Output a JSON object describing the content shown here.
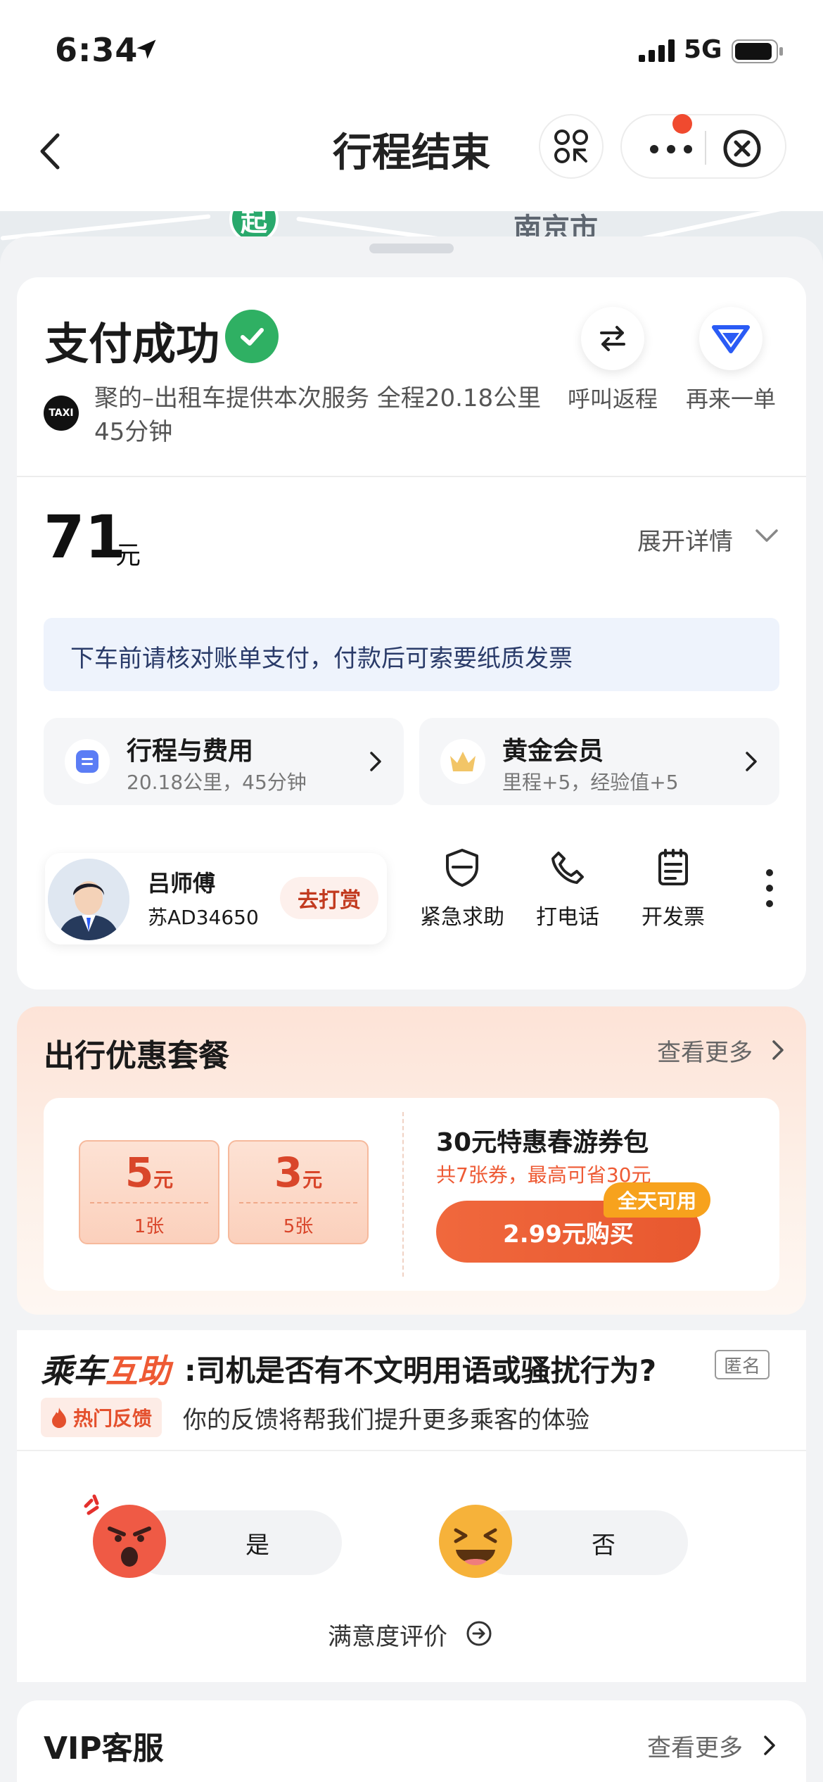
{
  "status_bar": {
    "time": "6:34",
    "network": "5G"
  },
  "nav": {
    "title": "行程结束"
  },
  "map": {
    "place_label": "南京市",
    "start_marker": "起"
  },
  "payment": {
    "title": "支付成功",
    "taxi_logo": "TAXI",
    "service_text": "聚的–出租车提供本次服务 全程20.18公里 45分钟",
    "actions": [
      {
        "label": "呼叫返程"
      },
      {
        "label": "再来一单"
      }
    ],
    "amount": "71",
    "amount_unit": "元",
    "expand_label": "展开详情",
    "notice": "下车前请核对账单支付，付款后可索要纸质发票"
  },
  "tiles": [
    {
      "title": "行程与费用",
      "subtitle": "20.18公里，45分钟"
    },
    {
      "title": "黄金会员",
      "subtitle": "里程+5，经验值+5"
    }
  ],
  "driver": {
    "name": "吕师傅",
    "plate": "苏AD34650",
    "tip_label": "去打赏"
  },
  "tools": [
    {
      "label": "紧急求助",
      "icon": "shield-icon"
    },
    {
      "label": "打电话",
      "icon": "phone-icon"
    },
    {
      "label": "开发票",
      "icon": "receipt-icon"
    }
  ],
  "promo": {
    "title": "出行优惠套餐",
    "more_label": "查看更多",
    "coupons": [
      {
        "value": "5",
        "unit": "元",
        "count": "1张"
      },
      {
        "value": "3",
        "unit": "元",
        "count": "5张"
      }
    ],
    "package_title": "30元特惠春游券包",
    "package_sub": "共7张券，最高可省30元",
    "badge": "全天可用",
    "buy_label": "2.99元购买"
  },
  "feedback": {
    "brand_prefix": "乘车",
    "brand_highlight": "互助",
    "question": ":司机是否有不文明用语或骚扰行为?",
    "anonymous": "匿名",
    "hot_tag": "热门反馈",
    "description": "你的反馈将帮我们提升更多乘客的体验",
    "yes_label": "是",
    "no_label": "否",
    "rating_link": "满意度评价"
  },
  "vip": {
    "title": "VIP客服",
    "more_label": "查看更多"
  },
  "colors": {
    "accent": "#ee5a34",
    "success": "#2fb063",
    "brand_blue": "#2a5bf5"
  }
}
